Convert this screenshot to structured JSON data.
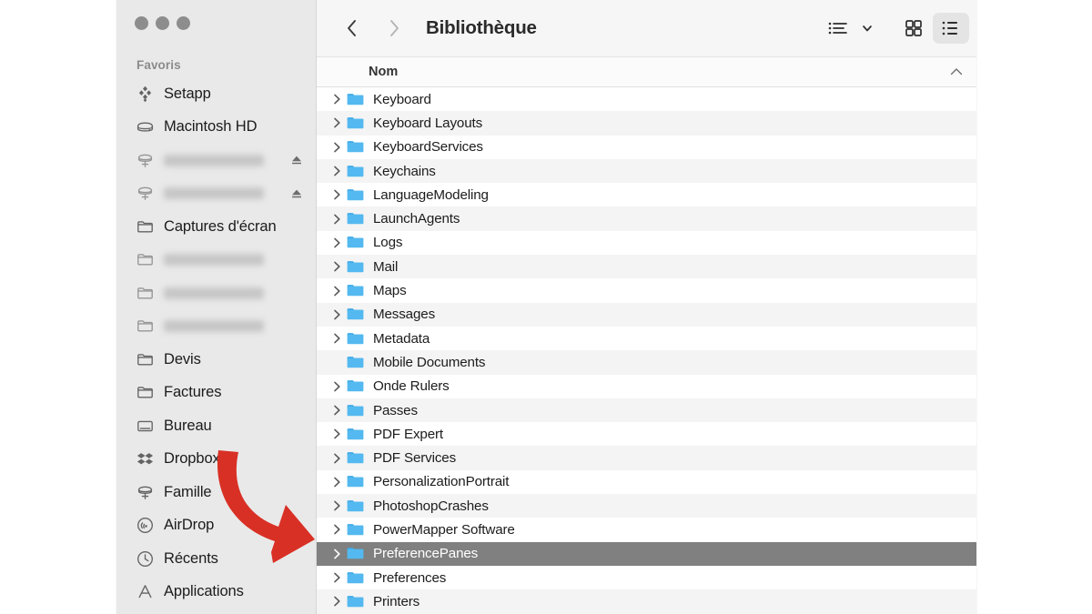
{
  "window": {
    "title": "Bibliothèque",
    "traffic_lights": [
      "close-button",
      "minimize-button",
      "zoom-button"
    ],
    "state": "inactive"
  },
  "colors": {
    "sidebar_bg": "#e9e9e9",
    "toolbar_bg": "#f6f6f6",
    "selection_gray": "#808080",
    "folder_blue": "#54b9f0",
    "annotation_red": "#d93025",
    "row_alt": "#f4f4f4"
  },
  "sidebar": {
    "section_title": "Favoris",
    "items": [
      {
        "label": "Setapp",
        "icon": "setapp-icon",
        "blurred": false,
        "eject": false
      },
      {
        "label": "Macintosh HD",
        "icon": "harddisk-icon",
        "blurred": false,
        "eject": false
      },
      {
        "label": "",
        "icon": "network-drive-icon",
        "blurred": true,
        "eject": true
      },
      {
        "label": "",
        "icon": "network-drive-icon",
        "blurred": true,
        "eject": true
      },
      {
        "label": "Captures d'écran",
        "icon": "folder-outline-icon",
        "blurred": false,
        "eject": false
      },
      {
        "label": "",
        "icon": "folder-outline-icon",
        "blurred": true,
        "eject": false
      },
      {
        "label": "",
        "icon": "folder-outline-icon",
        "blurred": true,
        "eject": false
      },
      {
        "label": "",
        "icon": "folder-outline-icon",
        "blurred": true,
        "eject": false
      },
      {
        "label": "Devis",
        "icon": "folder-outline-icon",
        "blurred": false,
        "eject": false
      },
      {
        "label": "Factures",
        "icon": "folder-outline-icon",
        "blurred": false,
        "eject": false
      },
      {
        "label": "Bureau",
        "icon": "desktop-icon",
        "blurred": false,
        "eject": false
      },
      {
        "label": "Dropbox",
        "icon": "dropbox-icon",
        "blurred": false,
        "eject": false
      },
      {
        "label": "Famille",
        "icon": "network-drive-icon",
        "blurred": false,
        "eject": false
      },
      {
        "label": "AirDrop",
        "icon": "airdrop-icon",
        "blurred": false,
        "eject": false
      },
      {
        "label": "Récents",
        "icon": "clock-icon",
        "blurred": false,
        "eject": false
      },
      {
        "label": "Applications",
        "icon": "applications-icon",
        "blurred": false,
        "eject": false
      }
    ]
  },
  "toolbar": {
    "back_icon": "chevron-left-icon",
    "forward_icon": "chevron-right-icon",
    "back_enabled": true,
    "forward_enabled": false,
    "buttons": [
      {
        "name": "group-by-button",
        "icon": "list-bullet-icon",
        "active": false
      },
      {
        "name": "view-icons-button",
        "icon": "grid-view-icon",
        "active": false
      },
      {
        "name": "view-list-button",
        "icon": "list-view-icon",
        "active": true
      }
    ]
  },
  "column_header": {
    "name": "Nom",
    "sort_direction": "ascending",
    "sort_icon": "chevron-up-icon"
  },
  "file_list": {
    "rows": [
      {
        "name": "Keyboard",
        "expandable": true,
        "selected": false
      },
      {
        "name": "Keyboard Layouts",
        "expandable": true,
        "selected": false
      },
      {
        "name": "KeyboardServices",
        "expandable": true,
        "selected": false
      },
      {
        "name": "Keychains",
        "expandable": true,
        "selected": false
      },
      {
        "name": "LanguageModeling",
        "expandable": true,
        "selected": false
      },
      {
        "name": "LaunchAgents",
        "expandable": true,
        "selected": false
      },
      {
        "name": "Logs",
        "expandable": true,
        "selected": false
      },
      {
        "name": "Mail",
        "expandable": true,
        "selected": false
      },
      {
        "name": "Maps",
        "expandable": true,
        "selected": false
      },
      {
        "name": "Messages",
        "expandable": true,
        "selected": false
      },
      {
        "name": "Metadata",
        "expandable": true,
        "selected": false
      },
      {
        "name": "Mobile Documents",
        "expandable": false,
        "selected": false
      },
      {
        "name": "Onde Rulers",
        "expandable": true,
        "selected": false
      },
      {
        "name": "Passes",
        "expandable": true,
        "selected": false
      },
      {
        "name": "PDF Expert",
        "expandable": true,
        "selected": false
      },
      {
        "name": "PDF Services",
        "expandable": true,
        "selected": false
      },
      {
        "name": "PersonalizationPortrait",
        "expandable": true,
        "selected": false
      },
      {
        "name": "PhotoshopCrashes",
        "expandable": true,
        "selected": false
      },
      {
        "name": "PowerMapper Software",
        "expandable": true,
        "selected": false
      },
      {
        "name": "PreferencePanes",
        "expandable": true,
        "selected": true
      },
      {
        "name": "Preferences",
        "expandable": true,
        "selected": false
      },
      {
        "name": "Printers",
        "expandable": true,
        "selected": false
      }
    ]
  },
  "annotation": {
    "name": "red-arrow",
    "shape": "curved-arrow-pointing-down-right",
    "target_row": "PreferencePanes"
  }
}
